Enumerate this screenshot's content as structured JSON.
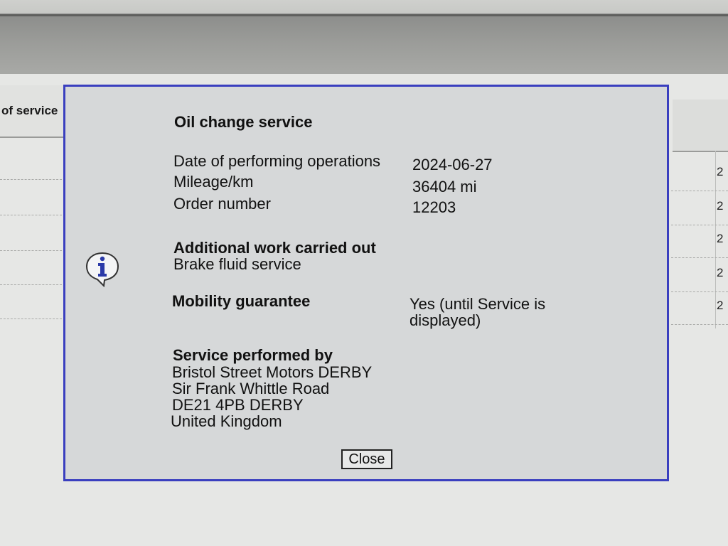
{
  "background": {
    "left_column_header": "of service",
    "right_column_cells": [
      "2",
      "2",
      "2",
      "2",
      "2"
    ]
  },
  "dialog": {
    "title": "Oil change service",
    "fields": [
      {
        "label": "Date of performing operations",
        "value": "2024-06-27"
      },
      {
        "label": "Mileage/km",
        "value": "36404 mi"
      },
      {
        "label": "Order number",
        "value": "12203"
      }
    ],
    "additional_work": {
      "heading": "Additional work carried out",
      "value": "Brake fluid service"
    },
    "mobility": {
      "heading": "Mobility guarantee",
      "value_line1": "Yes (until Service is",
      "value_line2": "displayed)"
    },
    "service_by": {
      "heading": "Service performed by",
      "lines": [
        "Bristol Street Motors DERBY",
        "Sir Frank Whittle Road",
        "DE21 4PB DERBY",
        "United Kingdom"
      ]
    },
    "close_label": "Close",
    "icon": "info-icon"
  },
  "colors": {
    "dialog_border": "#3a3fbf",
    "dialog_background": "#d6d8d9",
    "info_icon": "#2b3aa8"
  }
}
